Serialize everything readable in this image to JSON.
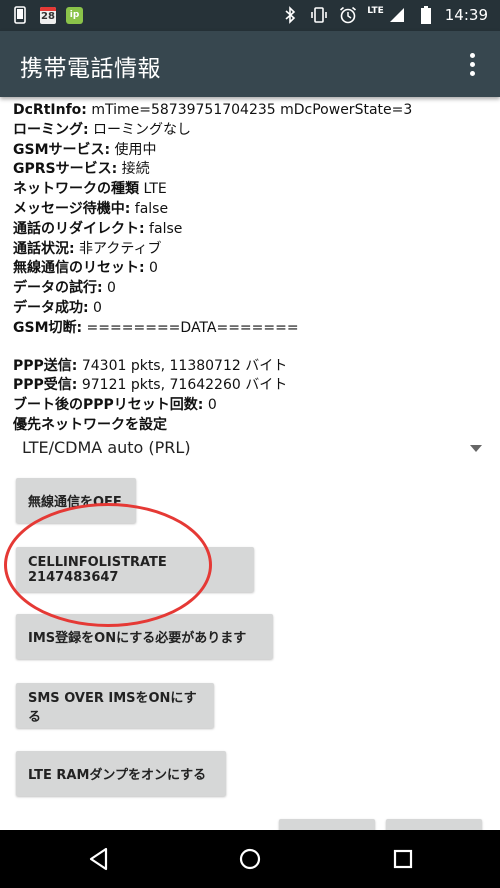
{
  "status_bar": {
    "time": "14:39",
    "calendar_day": "28",
    "app_icon_text": "ip",
    "network_type": "LTE",
    "left_icons": [
      "phone-icon",
      "calendar-icon",
      "app-icon"
    ],
    "right_icons": [
      "bluetooth-icon",
      "vibrate-icon",
      "alarm-icon",
      "signal-icon",
      "battery-icon"
    ]
  },
  "app_bar": {
    "title": "携帯電話情報"
  },
  "info_rows": [
    {
      "key": "DcRtInfo:",
      "value": " mTime=58739751704235 mDcPowerState=3"
    },
    {
      "key": "ローミング:",
      "value": " ローミングなし"
    },
    {
      "key": "GSMサービス:",
      "value": " 使用中"
    },
    {
      "key": "GPRSサービス:",
      "value": " 接続"
    },
    {
      "key": "ネットワークの種類",
      "value": " LTE"
    },
    {
      "key": "メッセージ待機中:",
      "value": " false"
    },
    {
      "key": "通話のリダイレクト:",
      "value": " false"
    },
    {
      "key": "通話状況:",
      "value": " 非アクティブ"
    },
    {
      "key": "無線通信のリセット:",
      "value": " 0"
    },
    {
      "key": "データの試行:",
      "value": " 0"
    },
    {
      "key": "データ成功:",
      "value": " 0"
    },
    {
      "key": "GSM切断:",
      "value": " ========DATA======="
    }
  ],
  "ppp_rows": [
    {
      "key": "PPP送信:",
      "value": " 74301 pkts, 11380712 バイト"
    },
    {
      "key": "PPP受信:",
      "value": " 97121 pkts, 71642260 バイト"
    },
    {
      "key": "ブート後のPPPリセット回数:",
      "value": " 0"
    },
    {
      "key": "優先ネットワークを設定",
      "value": ""
    }
  ],
  "preferred_network": {
    "selected": "LTE/CDMA auto (PRL)"
  },
  "buttons": {
    "radio_off": "無線通信をOFF",
    "cellinfo": "CELLINFOLISTRATE 2147483647",
    "ims_registration": "IMS登録をONにする必要があります",
    "sms_over_ims": "SMS OVER IMSをONにする",
    "lte_ram_dump": "LTE RAMダンプをオンにする",
    "extra_1": "",
    "extra_2": ""
  },
  "colors": {
    "status_bar": "#263238",
    "app_bar": "#37474f",
    "button": "#d6d7d7",
    "annotation_circle": "#e53935"
  }
}
